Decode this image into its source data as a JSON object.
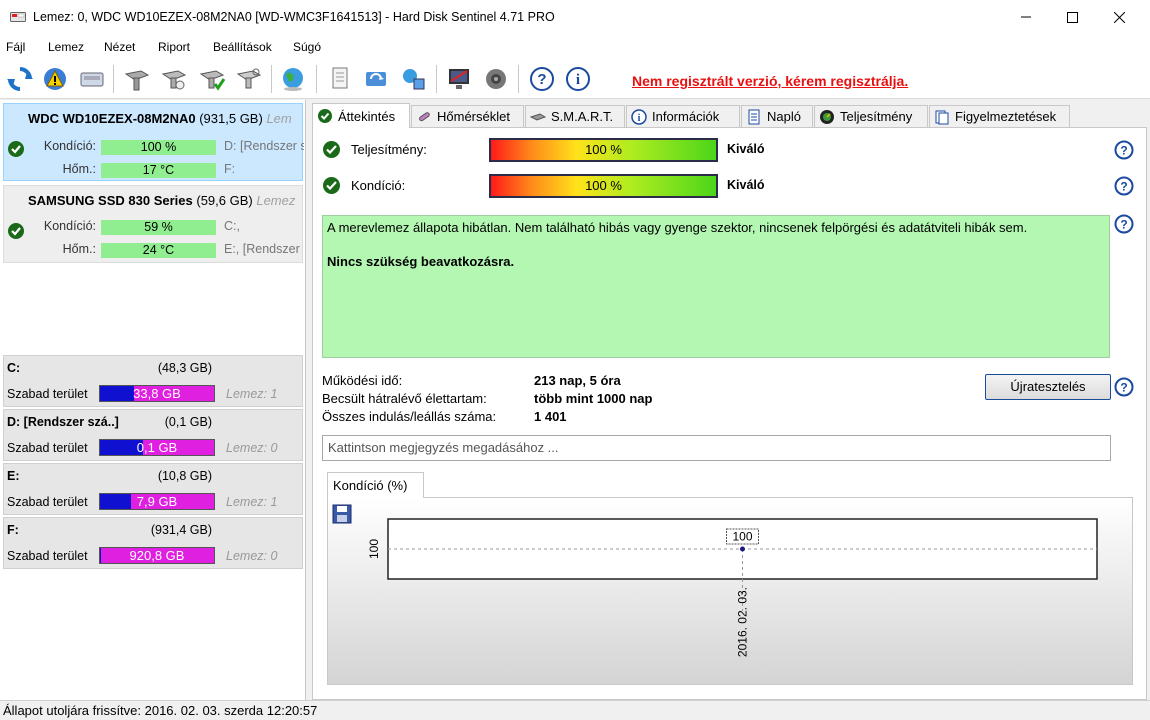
{
  "window": {
    "title": "Lemez: 0, WDC WD10EZEX-08M2NA0 [WD-WMC3F1641513]  -  Hard Disk Sentinel 4.71 PRO",
    "minimize_icon": "minimize-icon",
    "maximize_icon": "maximize-icon",
    "close_icon": "close-icon"
  },
  "menu": [
    "Fájl",
    "Lemez",
    "Nézet",
    "Riport",
    "Beállítások",
    "Súgó"
  ],
  "toolbar": {
    "registration_warning": "Nem regisztrált verzió, kérem regisztrálja."
  },
  "disks": [
    {
      "name": "WDC WD10EZEX-08M2NA0",
      "size": "(931,5 GB)",
      "lemez": "Lem",
      "kondicio_label": "Kondíció:",
      "kondicio": "100 %",
      "hom_label": "Hőm.:",
      "hom": "17 °C",
      "vol1": "D: [Rendszer s",
      "vol2": "F:"
    },
    {
      "name": "SAMSUNG SSD 830 Series",
      "size": "(59,6 GB)",
      "lemez": "Lemez",
      "kondicio_label": "Kondíció:",
      "kondicio": "59 %",
      "hom_label": "Hőm.:",
      "hom": "24 °C",
      "vol1": "C:,",
      "vol2": "E:,  [Rendszer"
    }
  ],
  "partitions": [
    {
      "name": "C:",
      "size": "(48,3 GB)",
      "free_label": "Szabad terület",
      "free": "33,8 GB",
      "disk": "Lemez: 1",
      "free_fraction": 0.7
    },
    {
      "name": "D: [Rendszer szá..]",
      "size": "(0,1 GB)",
      "free_label": "Szabad terület",
      "free": "0,1 GB",
      "disk": "Lemez: 0",
      "free_fraction": 0.62
    },
    {
      "name": "E:",
      "size": "(10,8 GB)",
      "free_label": "Szabad terület",
      "free": "7,9 GB",
      "disk": "Lemez: 1",
      "free_fraction": 0.73
    },
    {
      "name": "F:",
      "size": "(931,4 GB)",
      "free_label": "Szabad terület",
      "free": "920,8 GB",
      "disk": "Lemez: 0",
      "free_fraction": 0.99
    }
  ],
  "tabs": [
    "Áttekintés",
    "Hőmérséklet",
    "S.M.A.R.T.",
    "Információk",
    "Napló",
    "Teljesítmény",
    "Figyelmeztetések"
  ],
  "overview": {
    "teljesitmeny_label": "Teljesítmény:",
    "teljesitmeny_value": "100 %",
    "teljesitmeny_rating": "Kiváló",
    "kondicio_label": "Kondíció:",
    "kondicio_value": "100 %",
    "kondicio_rating": "Kiváló",
    "status_text": "A merevlemez állapota hibátlan. Nem található hibás vagy gyenge szektor, nincsenek felpörgési és adatátviteli hibák sem.",
    "status_action": "Nincs szükség beavatkozásra.",
    "uptime_label": "Működési idő:",
    "uptime_value": "213 nap, 5 óra",
    "lifetime_label": "Becsült hátralévő élettartam:",
    "lifetime_value": "több mint 1000 nap",
    "startstop_label": "Összes indulás/leállás száma:",
    "startstop_value": "1 401",
    "retest_button": "Újratesztelés",
    "comment_placeholder": "Kattintson megjegyzés megadásához ..."
  },
  "chart_tab_label": "Kondíció  (%)",
  "chart_data": {
    "type": "line",
    "x": [
      "2016. 02. 03."
    ],
    "series": [
      {
        "values": [
          100
        ]
      }
    ],
    "ylabel": "",
    "xlabel": "",
    "y_tick_labels": [
      "100"
    ],
    "data_labels": [
      "100"
    ],
    "grid": true
  },
  "statusbar": {
    "text": "Állapot utoljára frissítve: 2016. 02. 03. szerda 12:20:57"
  },
  "colors": {
    "selected_disk_bg": "#cce8ff",
    "status_ok_bg": "#b3f7b3",
    "free_space": "#e020e0",
    "used_space": "#1010d0",
    "registration_warning": "#e81010"
  }
}
